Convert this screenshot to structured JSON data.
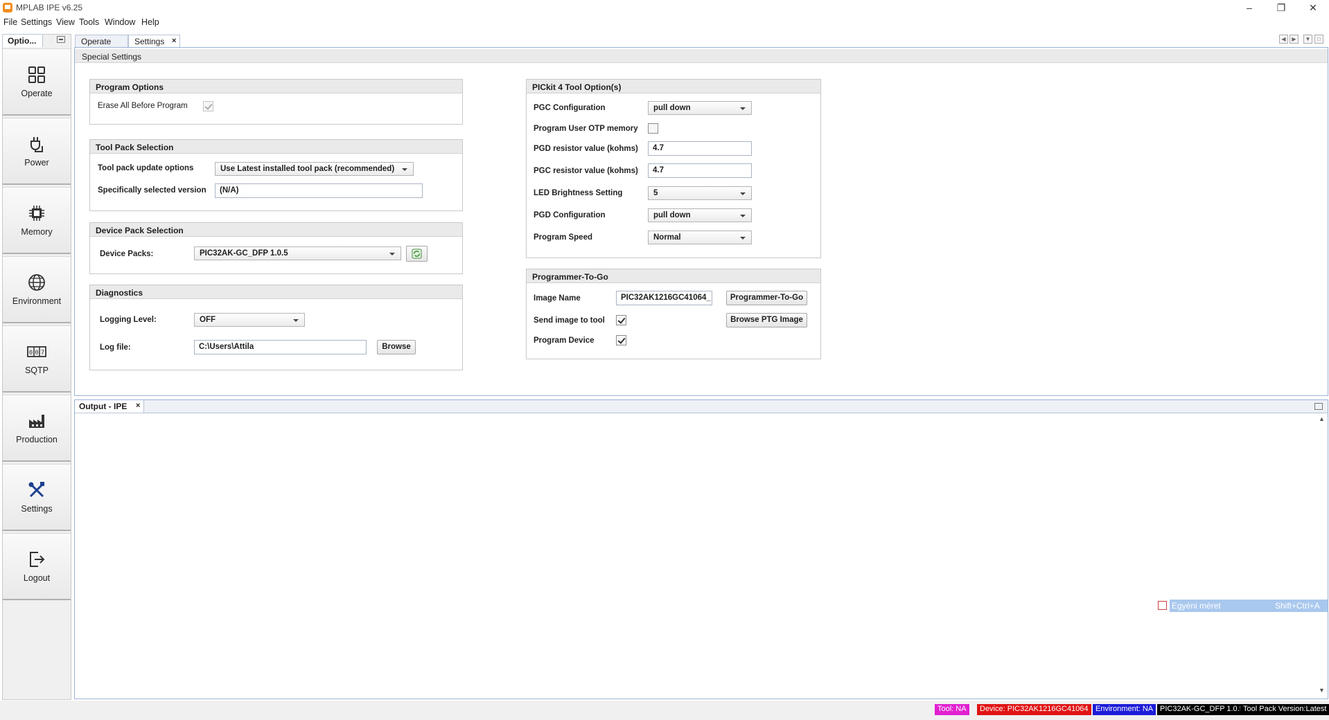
{
  "window": {
    "title": "MPLAB IPE v6.25",
    "minimize_icon": "minimize-icon",
    "restore_icon": "restore-icon",
    "close_icon": "close-icon"
  },
  "menu": [
    "File",
    "Settings",
    "View",
    "Tools",
    "Window",
    "Help"
  ],
  "left_panel": {
    "tab_label": "Optio...",
    "items": [
      {
        "label": "Operate",
        "icon": "grid-icon"
      },
      {
        "label": "Power",
        "icon": "power-plug-icon"
      },
      {
        "label": "Memory",
        "icon": "chip-icon"
      },
      {
        "label": "Environment",
        "icon": "globe-icon"
      },
      {
        "label": "SQTP",
        "icon": "counter-icon"
      },
      {
        "label": "Production",
        "icon": "factory-icon"
      },
      {
        "label": "Settings",
        "icon": "tools-icon"
      },
      {
        "label": "Logout",
        "icon": "logout-icon"
      }
    ]
  },
  "doc_tabs": {
    "operate": "Operate",
    "settings": "Settings",
    "close": "×"
  },
  "special_settings": {
    "title": "Special Settings",
    "program_options": {
      "title": "Program Options",
      "erase_all_label": "Erase All Before Program",
      "erase_all_checked": true
    },
    "tool_pack": {
      "title": "Tool Pack Selection",
      "update_options_label": "Tool pack update options",
      "update_options_value": "Use Latest installed tool pack (recommended)",
      "version_label": "Specifically selected version",
      "version_value": "(N/A)"
    },
    "device_pack": {
      "title": "Device Pack Selection",
      "packs_label": "Device Packs:",
      "packs_value": "PIC32AK-GC_DFP 1.0.5"
    },
    "diagnostics": {
      "title": "Diagnostics",
      "logging_label": "Logging Level:",
      "logging_value": "OFF",
      "logfile_label": "Log file:",
      "logfile_value": "C:\\Users\\Attila",
      "browse_label": "Browse"
    },
    "pickit": {
      "title": "PICkit 4 Tool Option(s)",
      "pgc_config_label": "PGC Configuration",
      "pgc_config_value": "pull down",
      "otp_label": "Program User OTP memory",
      "otp_checked": false,
      "pgd_res_label": "PGD resistor value (kohms)",
      "pgd_res_value": "4.7",
      "pgc_res_label": "PGC resistor value (kohms)",
      "pgc_res_value": "4.7",
      "led_label": "LED Brightness Setting",
      "led_value": "5",
      "pgd_config_label": "PGD Configuration",
      "pgd_config_value": "pull down",
      "speed_label": "Program Speed",
      "speed_value": "Normal"
    },
    "ptg": {
      "title": "Programmer-To-Go",
      "image_name_label": "Image Name",
      "image_name_value": "PIC32AK1216GC41064_",
      "ptg_button": "Programmer-To-Go",
      "send_label": "Send image to tool",
      "send_checked": true,
      "browse_ptg_button": "Browse PTG Image",
      "program_device_label": "Program Device",
      "program_device_checked": true
    }
  },
  "output": {
    "tab_label": "Output - IPE",
    "close": "×"
  },
  "context_hint": {
    "label": "Egyéni méret",
    "shortcut": "Shift+Ctrl+A"
  },
  "status": [
    {
      "text": "Tool: NA",
      "color": "#e020d0"
    },
    {
      "text": "Device: PIC32AK1216GC41064",
      "color": "#e01414"
    },
    {
      "text": "Environment: NA",
      "color": "#1c1cd8"
    },
    {
      "text": "PIC32AK-GC_DFP 1.0.5",
      "color": "#000000"
    },
    {
      "text": "Tool Pack Version:Latest",
      "color": "#000000"
    }
  ]
}
